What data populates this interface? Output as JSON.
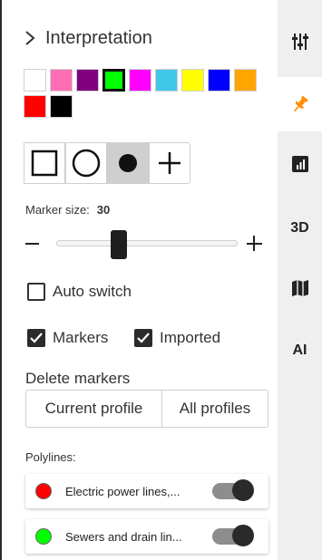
{
  "panel": {
    "title": "Interpretation",
    "colors": [
      "#ffffff",
      "#ff6eb4",
      "#800080",
      "#00ff00",
      "#ff00ff",
      "#40c8e8",
      "#ffff00",
      "#0000ff",
      "#ffa500",
      "#ff0000",
      "#000000"
    ],
    "selected_color": "#00ff00",
    "shapes": [
      {
        "name": "square-marker",
        "active": false
      },
      {
        "name": "circle-marker",
        "active": false
      },
      {
        "name": "dot-marker",
        "active": true
      },
      {
        "name": "cross-marker",
        "active": false
      }
    ],
    "marker_size_label": "Marker size:",
    "marker_size_value": "30",
    "slider_fraction": 0.3,
    "auto_switch_label": "Auto switch",
    "auto_switch_checked": false,
    "markers_label": "Markers",
    "markers_checked": true,
    "imported_label": "Imported",
    "imported_checked": true,
    "delete_label": "Delete markers",
    "current_profile_label": "Current profile",
    "all_profiles_label": "All profiles",
    "polylines_label": "Polylines:",
    "polylines": [
      {
        "name": "Electric power lines,...",
        "color": "#ff0000",
        "enabled": true
      },
      {
        "name": "Sewers and drain lin...",
        "color": "#00ff00",
        "enabled": true
      }
    ]
  },
  "rail": {
    "items": [
      {
        "name": "sliders-icon",
        "active": false
      },
      {
        "name": "pin-icon",
        "active": true
      },
      {
        "name": "chart-icon",
        "active": false
      },
      {
        "name": "3d",
        "label": "3D",
        "active": false
      },
      {
        "name": "map-icon",
        "active": false
      },
      {
        "name": "ai",
        "label": "AI",
        "active": false
      }
    ],
    "accent": "#ff8c00"
  }
}
